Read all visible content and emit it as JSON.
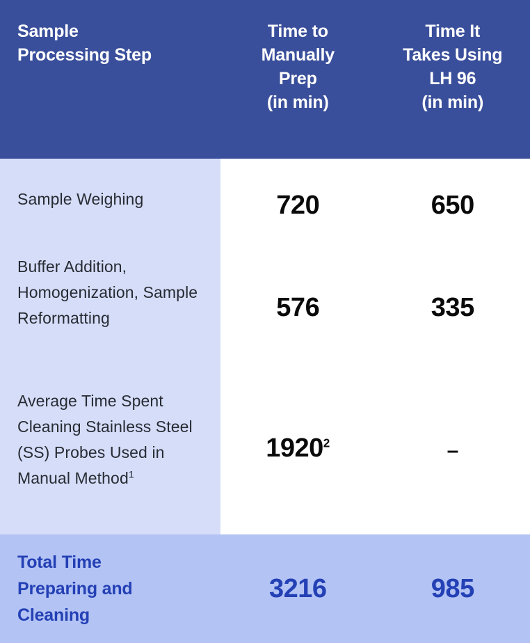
{
  "table": {
    "header": {
      "col_step": {
        "lines": [
          "Sample",
          "Processing Step"
        ]
      },
      "col_manual": {
        "lines": [
          "Time to",
          "Manually",
          "Prep",
          "(in min)"
        ]
      },
      "col_lh96": {
        "lines": [
          "Time It",
          "Takes Using",
          "LH 96",
          "(in min)"
        ]
      }
    },
    "rows": [
      {
        "step": "Sample Weighing",
        "step_superscript": "",
        "manual": "720",
        "manual_superscript": "",
        "lh96": "650"
      },
      {
        "step": "Buffer Addition, Homogenization, Sample Reformatting",
        "step_superscript": "",
        "manual": "576",
        "manual_superscript": "",
        "lh96": "335"
      },
      {
        "step": "Average Time Spent Cleaning Stainless Steel (SS) Probes Used in Manual Method",
        "step_superscript": "1",
        "manual": "1920",
        "manual_superscript": "2",
        "lh96": "–"
      }
    ],
    "total": {
      "label_lines": [
        "Total Time",
        "Preparing and",
        "Cleaning"
      ],
      "manual": "3216",
      "lh96": "985"
    },
    "colors": {
      "header_bg": "#3a4f9b",
      "header_text": "#ffffff",
      "step_column_bg": "#d6ddf8",
      "value_column_bg": "#ffffff",
      "body_text": "#272b33",
      "value_text": "#0a0a0a",
      "total_bg": "#b3c3f4",
      "total_text": "#2440b5"
    }
  },
  "chart_data": {
    "type": "table",
    "title": "Sample Processing Step Timing Comparison",
    "columns": [
      "Sample Processing Step",
      "Time to Manually Prep (in min)",
      "Time It Takes Using LH 96 (in min)"
    ],
    "categories": [
      "Sample Weighing",
      "Buffer Addition, Homogenization, Sample Reformatting",
      "Average Time Spent Cleaning Stainless Steel (SS) Probes Used in Manual Method",
      "Total Time Preparing and Cleaning"
    ],
    "series": [
      {
        "name": "Time to Manually Prep (in min)",
        "values": [
          720,
          576,
          1920,
          3216
        ]
      },
      {
        "name": "Time It Takes Using LH 96 (in min)",
        "values": [
          650,
          335,
          null,
          985
        ]
      }
    ],
    "notes": [
      "1",
      "2"
    ],
    "ylabel": "Minutes",
    "xlabel": "Sample Processing Step"
  }
}
